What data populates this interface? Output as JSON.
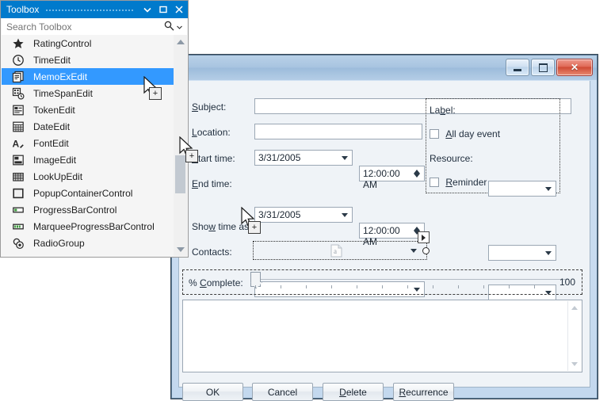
{
  "toolbox": {
    "title": "Toolbox",
    "titlebar_buttons": [
      {
        "name": "dropdown-icon",
        "glyph": "chevron-down"
      },
      {
        "name": "maximize-icon",
        "glyph": "square"
      },
      {
        "name": "close-icon",
        "glyph": "x"
      }
    ],
    "search": {
      "placeholder": "Search Toolbox",
      "value": "",
      "icon": "search-icon",
      "dropdown_icon": "chevron-down-icon"
    },
    "items": [
      {
        "label": "RatingControl",
        "icon": "star-icon",
        "selected": false
      },
      {
        "label": "TimeEdit",
        "icon": "clock-icon",
        "selected": false
      },
      {
        "label": "MemoExEdit",
        "icon": "memo-icon",
        "selected": true
      },
      {
        "label": "TimeSpanEdit",
        "icon": "timespan-icon",
        "selected": false
      },
      {
        "label": "TokenEdit",
        "icon": "token-icon",
        "selected": false
      },
      {
        "label": "DateEdit",
        "icon": "calendar-grid-icon",
        "selected": false
      },
      {
        "label": "FontEdit",
        "icon": "font-pen-icon",
        "selected": false
      },
      {
        "label": "ImageEdit",
        "icon": "image-icon",
        "selected": false
      },
      {
        "label": "LookUpEdit",
        "icon": "lookup-grid-icon",
        "selected": false
      },
      {
        "label": "PopupContainerControl",
        "icon": "popup-square-icon",
        "selected": false
      },
      {
        "label": "ProgressBarControl",
        "icon": "progressbar-icon",
        "selected": false
      },
      {
        "label": "MarqueeProgressBarControl",
        "icon": "marquee-progressbar-icon",
        "selected": false
      },
      {
        "label": "RadioGroup",
        "icon": "radiogroup-icon",
        "selected": false
      }
    ],
    "scrollbar": {
      "up_icon": "scroll-up-icon",
      "down_icon": "scroll-down-icon"
    }
  },
  "dialog": {
    "title": "",
    "app_icon": "appointment-icon",
    "window_buttons": {
      "minimize": "minimize-icon",
      "maximize": "maximize-icon",
      "close": "close-icon"
    },
    "fields": {
      "subject": {
        "label": "Subject:",
        "accel": "S",
        "value": ""
      },
      "location": {
        "label": "Location:",
        "accel": "L",
        "value": ""
      },
      "start_time": {
        "label": "Start time:",
        "accel": "S",
        "date": "3/31/2005",
        "time": "12:00:00 AM"
      },
      "end_time": {
        "label": "End time:",
        "accel": "E",
        "date": "3/31/2005",
        "time": "12:00:00 AM"
      },
      "show_time_as": {
        "label": "Show time as:",
        "accel": "w",
        "value": ""
      },
      "contacts": {
        "label": "Contacts:",
        "accel": "",
        "value": ""
      },
      "label_field": {
        "label": "Label:",
        "accel": "b",
        "value": ""
      },
      "all_day_event": {
        "label": "All day event",
        "accel": "A",
        "checked": false
      },
      "resource": {
        "label": "Resource:",
        "accel": "",
        "value": ""
      },
      "reminder": {
        "label": "Reminder",
        "accel": "R",
        "checked": false,
        "value": ""
      },
      "percent_complete": {
        "label": "% Complete:",
        "accel": "C",
        "value": 0,
        "max_label": "100"
      },
      "description": {
        "value": ""
      }
    },
    "buttons": [
      {
        "label": "OK",
        "accel": ""
      },
      {
        "label": "Cancel",
        "accel": ""
      },
      {
        "label": "Delete",
        "accel": "D"
      },
      {
        "label": "Recurrence",
        "accel": "R"
      }
    ]
  },
  "cursors": {
    "drag_badge": "+",
    "drop_preview_icon": "memo-drop-preview-icon"
  },
  "colors": {
    "toolbox_titlebar": "#007acc",
    "selection_blue": "#3399ff",
    "dialog_frame": "#c3d8ee",
    "client_bg": "#eff3f7",
    "close_button_red": "#cf4a34"
  }
}
